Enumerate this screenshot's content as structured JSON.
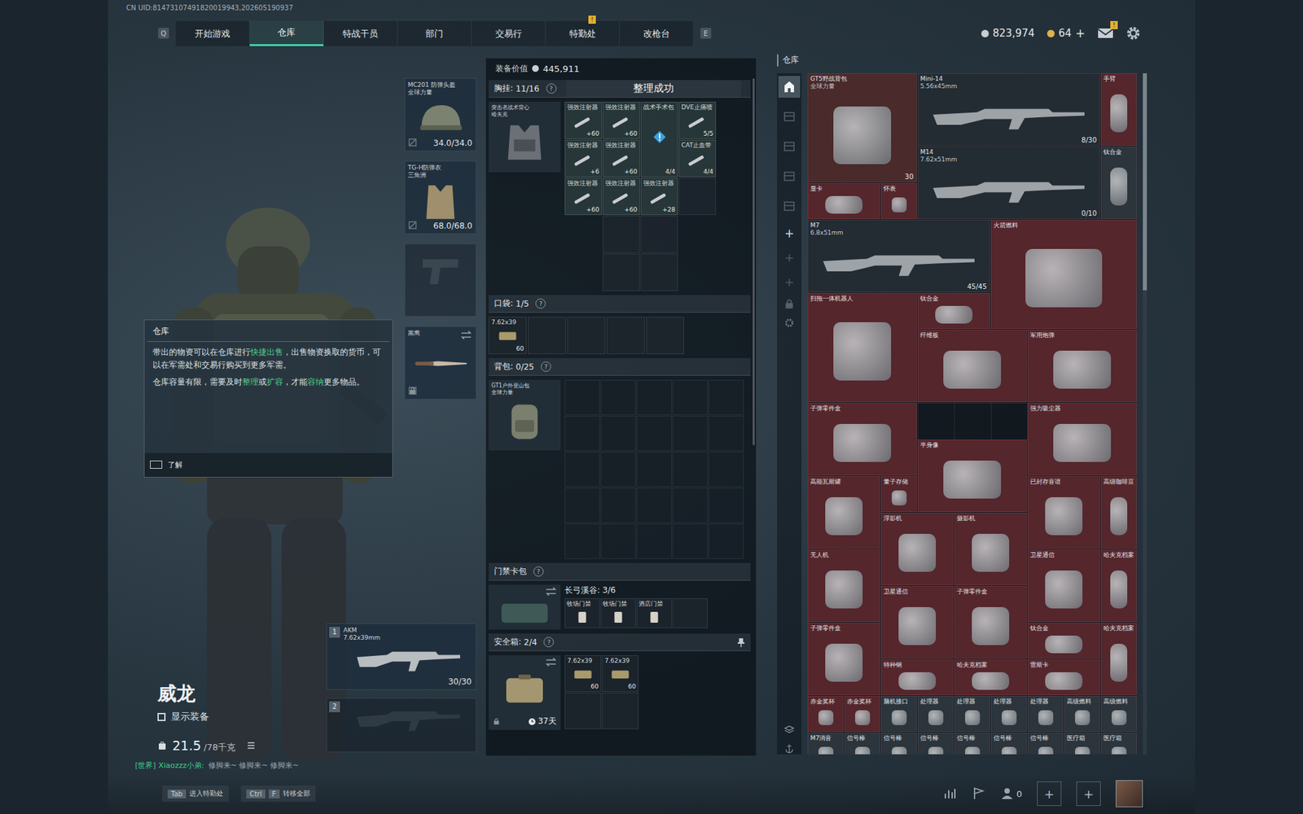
{
  "top_bar": {
    "uid": "CN UID:81473107491820019943,202605190937",
    "nav_prev_key": "Q",
    "nav_next_key": "E",
    "tabs": [
      {
        "label": "开始游戏",
        "selected": false,
        "badge": null
      },
      {
        "label": "仓库",
        "selected": true,
        "badge": null
      },
      {
        "label": "特战干员",
        "selected": false,
        "badge": null
      },
      {
        "label": "部门",
        "selected": false,
        "badge": null
      },
      {
        "label": "交易行",
        "selected": false,
        "badge": null
      },
      {
        "label": "特勤处",
        "selected": false,
        "badge": "!"
      },
      {
        "label": "改枪台",
        "selected": false,
        "badge": null
      }
    ],
    "currencies": [
      {
        "value": "823,974",
        "plus": null,
        "color": "#c9ced3"
      },
      {
        "value": "64",
        "plus": "+",
        "color": "#e0b04a"
      }
    ],
    "mail_badge": "!"
  },
  "operator": {
    "name": "威龙",
    "show_equipment": {
      "label": "显示装备",
      "checked": false
    },
    "weight": "21.5",
    "weight_max": "/78千克"
  },
  "chat": {
    "channel": "[世界]",
    "user": "Xiaozzz小弟:",
    "message": "修脚来~ 修脚来~ 修脚来~"
  },
  "tooltip": {
    "title": "仓库",
    "paragraphs": [
      [
        {
          "text": "带出的物资可以在仓库进行",
          "highlight": false
        },
        {
          "text": "快捷出售",
          "highlight": true
        },
        {
          "text": "，出售物资换取的货币，可以在军需处和交易行购买到更多军需。",
          "highlight": false
        }
      ],
      [
        {
          "text": "仓库容量有限，需要及时",
          "highlight": false
        },
        {
          "text": "整理",
          "highlight": true
        },
        {
          "text": "或",
          "highlight": false
        },
        {
          "text": "扩容",
          "highlight": true
        },
        {
          "text": "，才能",
          "highlight": false
        },
        {
          "text": "容纳",
          "highlight": true
        },
        {
          "text": "更多物品。",
          "highlight": false
        }
      ]
    ],
    "button": "了解"
  },
  "equipment": [
    {
      "label": "MC201 防弹头盔",
      "sub": "全球力量",
      "durability": "34.0/34.0",
      "kind": "helmet",
      "empty": false,
      "locked": false
    },
    {
      "label": "TG-H防弹衣",
      "sub": "三角洲",
      "durability": "68.0/68.0",
      "kind": "armor",
      "empty": false,
      "locked": false
    },
    {
      "label": null,
      "sub": null,
      "durability": null,
      "kind": "pistol",
      "empty": true,
      "locked": false
    },
    {
      "label": "黑鹰",
      "sub": null,
      "durability": null,
      "kind": "melee",
      "empty": false,
      "locked": true
    }
  ],
  "weapons": [
    {
      "slot": "1",
      "name": "AKM",
      "caliber": "7.62x39mm",
      "ammo": "30/30",
      "empty": false
    },
    {
      "slot": "2",
      "name": null,
      "caliber": null,
      "ammo": null,
      "empty": true
    }
  ],
  "loadout": {
    "value_label": "装备价值",
    "value": "445,911",
    "toast": "整理成功",
    "chest": {
      "label": "胸挂:",
      "count": "11/16",
      "help": "?",
      "rig_name": "突击者战术背心",
      "rig_sub": "哈夫克",
      "items": [
        {
          "name": "强效注射器",
          "amount": "+60",
          "alert": false
        },
        {
          "name": "强效注射器",
          "amount": "+60",
          "alert": false
        },
        {
          "name": "战术手术包",
          "amount": "4/4",
          "alert": true
        },
        {
          "name": "DVE止痛喷",
          "amount": "5/5",
          "alert": false
        },
        {
          "name": "强效注射器",
          "amount": "+6",
          "alert": false
        },
        {
          "name": "强效注射器",
          "amount": "+60",
          "alert": false
        },
        {
          "name": "CAT止血带",
          "amount": "4/4",
          "alert": false
        },
        {
          "name": "强效注射器",
          "amount": "+60",
          "alert": false
        },
        {
          "name": "强效注射器",
          "amount": "+60",
          "alert": false
        },
        {
          "name": "强效注射器",
          "amount": "+28",
          "alert": false
        }
      ]
    },
    "pocket": {
      "label": "口袋:",
      "count": "1/5",
      "help": "?",
      "items": [
        {
          "name": "7.62x39",
          "amount": "60"
        }
      ]
    },
    "backpack": {
      "label": "背包:",
      "count": "0/25",
      "help": "?",
      "name": "GT1户外登山包",
      "sub": "全球力量"
    },
    "keycard": {
      "label": "门禁卡包",
      "help": "?",
      "area": "长弓溪谷: 3/6",
      "cards": [
        "牧场门禁",
        "牧场门禁",
        "酒店门禁"
      ]
    },
    "safebox": {
      "label": "安全箱:",
      "count": "2/4",
      "help": "?",
      "timer": "37天",
      "items": [
        {
          "name": "7.62x39",
          "amount": "60"
        },
        {
          "name": "7.62x39",
          "amount": "60"
        }
      ]
    }
  },
  "warehouse": {
    "title": "仓库",
    "sidebar_tabs": [
      {
        "selected": true
      },
      {
        "selected": false
      },
      {
        "selected": false
      },
      {
        "selected": false
      },
      {
        "selected": false
      }
    ],
    "add_buttons": [
      {
        "label": "+",
        "disabled": false
      },
      {
        "label": "+",
        "disabled": true
      },
      {
        "label": "+",
        "disabled": true
      }
    ],
    "items": [
      {
        "name": "GT5野战背包",
        "detail": "全球力量",
        "count": "30",
        "color": "#4a2a2a",
        "kind": "prop"
      },
      {
        "name": "Mini-14",
        "detail": "5.56x45mm",
        "count": "8/30",
        "color": "#232b33",
        "kind": "gun"
      },
      {
        "name": "手臂",
        "detail": null,
        "count": null,
        "color": "#55262c",
        "kind": "prop"
      },
      {
        "name": "M14",
        "detail": "7.62x51mm",
        "count": "0/10",
        "color": "#232b33",
        "kind": "gun"
      },
      {
        "name": "钛合金",
        "detail": null,
        "count": null,
        "color": "#2c343c",
        "kind": "prop"
      },
      {
        "name": "显卡",
        "detail": null,
        "count": null,
        "color": "#55262c",
        "kind": "prop"
      },
      {
        "name": "怀表",
        "detail": null,
        "count": null,
        "color": "#55262c",
        "kind": "prop"
      },
      {
        "name": "M7",
        "detail": "6.8x51mm",
        "count": "45/45",
        "color": "#232b33",
        "kind": "gun"
      },
      {
        "name": "火箭燃料",
        "detail": null,
        "count": null,
        "color": "#55262c",
        "kind": "prop"
      },
      {
        "name": "扫拖一体机器人",
        "detail": null,
        "count": null,
        "color": "#55262c",
        "kind": "prop"
      },
      {
        "name": "钛合金",
        "detail": null,
        "count": null,
        "color": "#55262c",
        "kind": "prop"
      },
      {
        "name": "纤维板",
        "detail": null,
        "count": null,
        "color": "#55262c",
        "kind": "prop"
      },
      {
        "name": "军用炮弹",
        "detail": null,
        "count": null,
        "color": "#55262c",
        "kind": "prop"
      },
      {
        "name": "子弹零件盒",
        "detail": null,
        "count": null,
        "color": "#55262c",
        "kind": "prop"
      },
      {
        "name": "强力吸尘器",
        "detail": null,
        "count": null,
        "color": "#55262c",
        "kind": "prop"
      },
      {
        "name": "半身像",
        "detail": null,
        "count": null,
        "color": "#55262c",
        "kind": "prop"
      },
      {
        "name": "高能瓦斯罐",
        "detail": null,
        "count": null,
        "color": "#55262c",
        "kind": "prop"
      },
      {
        "name": "量子存储",
        "detail": null,
        "count": null,
        "color": "#55262c",
        "kind": "prop"
      },
      {
        "name": "已封存音谱",
        "detail": null,
        "count": null,
        "color": "#55262c",
        "kind": "prop"
      },
      {
        "name": "高级咖啡豆",
        "detail": null,
        "count": null,
        "color": "#55262c",
        "kind": "prop"
      },
      {
        "name": "浮影机",
        "detail": null,
        "count": null,
        "color": "#55262c",
        "kind": "prop"
      },
      {
        "name": "摄影机",
        "detail": null,
        "count": null,
        "color": "#55262c",
        "kind": "prop"
      },
      {
        "name": "无人机",
        "detail": null,
        "count": null,
        "color": "#55262c",
        "kind": "prop"
      },
      {
        "name": "卫星通信",
        "detail": null,
        "count": null,
        "color": "#55262c",
        "kind": "prop"
      },
      {
        "name": "哈夫克档案",
        "detail": null,
        "count": null,
        "color": "#55262c",
        "kind": "prop"
      },
      {
        "name": "卫星通信",
        "detail": null,
        "count": null,
        "color": "#55262c",
        "kind": "prop"
      },
      {
        "name": "子弹零件盒",
        "detail": null,
        "count": null,
        "color": "#55262c",
        "kind": "prop"
      },
      {
        "name": "子弹零件盒",
        "detail": null,
        "count": null,
        "color": "#55262c",
        "kind": "prop"
      },
      {
        "name": "钛合金",
        "detail": null,
        "count": null,
        "color": "#55262c",
        "kind": "prop"
      },
      {
        "name": "哈夫克档案",
        "detail": null,
        "count": null,
        "color": "#55262c",
        "kind": "prop"
      },
      {
        "name": "特种钢",
        "detail": null,
        "count": null,
        "color": "#55262c",
        "kind": "prop"
      },
      {
        "name": "哈夫克档案",
        "detail": null,
        "count": null,
        "color": "#55262c",
        "kind": "prop"
      },
      {
        "name": "雷斯卡",
        "detail": null,
        "count": null,
        "color": "#55262c",
        "kind": "prop"
      },
      {
        "name": "赤金奖杯",
        "detail": null,
        "count": null,
        "color": "#55262c",
        "kind": "prop"
      },
      {
        "name": "赤金奖杯",
        "detail": null,
        "count": null,
        "color": "#55262c",
        "kind": "prop"
      },
      {
        "name": "脑机接口",
        "detail": null,
        "count": null,
        "color": "#2c343c",
        "kind": "prop"
      },
      {
        "name": "处理器",
        "detail": null,
        "count": null,
        "color": "#2c343c",
        "kind": "prop"
      },
      {
        "name": "处理器",
        "detail": null,
        "count": null,
        "color": "#2c343c",
        "kind": "prop"
      },
      {
        "name": "处理器",
        "detail": null,
        "count": null,
        "color": "#2c343c",
        "kind": "prop"
      },
      {
        "name": "处理器",
        "detail": null,
        "count": null,
        "color": "#2c343c",
        "kind": "prop"
      },
      {
        "name": "高级燃料",
        "detail": null,
        "count": null,
        "color": "#2c343c",
        "kind": "prop"
      },
      {
        "name": "高级燃料",
        "detail": null,
        "count": null,
        "color": "#2c343c",
        "kind": "prop"
      },
      {
        "name": "M7消音",
        "detail": null,
        "count": null,
        "color": "#2c343c",
        "kind": "prop"
      },
      {
        "name": "信号棒",
        "detail": null,
        "count": null,
        "color": "#2c343c",
        "kind": "prop"
      },
      {
        "name": "信号棒",
        "detail": null,
        "count": null,
        "color": "#2c343c",
        "kind": "prop"
      },
      {
        "name": "信号棒",
        "detail": null,
        "count": null,
        "color": "#2c343c",
        "kind": "prop"
      },
      {
        "name": "信号棒",
        "detail": null,
        "count": null,
        "color": "#2c343c",
        "kind": "prop"
      },
      {
        "name": "信号棒",
        "detail": null,
        "count": null,
        "color": "#2c343c",
        "kind": "prop"
      },
      {
        "name": "信号棒",
        "detail": null,
        "count": null,
        "color": "#2c343c",
        "kind": "prop"
      },
      {
        "name": "医疗箱",
        "detail": null,
        "count": null,
        "color": "#2c343c",
        "kind": "prop"
      },
      {
        "name": "医疗箱",
        "detail": null,
        "count": null,
        "color": "#2c343c",
        "kind": "prop"
      }
    ]
  },
  "bottom_bar": {
    "hints": [
      {
        "keys": [
          "Tab"
        ],
        "label": "进入特勤处"
      },
      {
        "keys": [
          "Ctrl",
          "F"
        ],
        "label": "转移全部"
      }
    ],
    "friends": "0",
    "slots": [
      "+",
      "+"
    ]
  }
}
